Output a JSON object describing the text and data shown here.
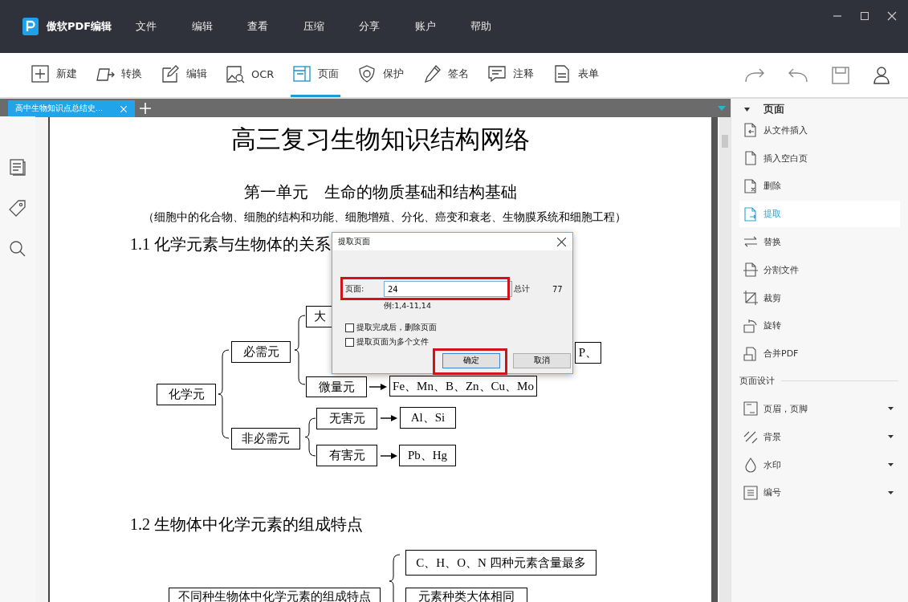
{
  "app": {
    "name": "傲软PDF编辑",
    "menu": [
      "文件",
      "编辑",
      "查看",
      "压缩",
      "分享",
      "账户",
      "帮助"
    ]
  },
  "toolbar": {
    "tools": [
      {
        "label": "新建",
        "kind": "plus",
        "selected": false
      },
      {
        "label": "转换",
        "kind": "convert",
        "selected": false
      },
      {
        "label": "编辑",
        "kind": "edit",
        "selected": false
      },
      {
        "label": "OCR",
        "kind": "ocr",
        "selected": false
      },
      {
        "label": "页面",
        "kind": "page",
        "selected": true
      },
      {
        "label": "保护",
        "kind": "shield",
        "selected": false
      },
      {
        "label": "签名",
        "kind": "pen",
        "selected": false
      },
      {
        "label": "注释",
        "kind": "comment",
        "selected": false
      },
      {
        "label": "表单",
        "kind": "form",
        "selected": false
      }
    ]
  },
  "tabs": [
    {
      "label": "高中生物知识点总结史...",
      "selected": true
    }
  ],
  "document": {
    "title": "高三复习生物知识结构网络",
    "unit": "第一单元　生命的物质基础和结构基础",
    "subtitle": "（细胞中的化合物、细胞的结构和功能、细胞增殖、分化、癌变和衰老、生物膜系统和细胞工程）",
    "sections": [
      {
        "heading": "1.1 化学元素与生物体的关系",
        "nodes": [
          {
            "text": "化学元"
          },
          {
            "text": "必需元"
          },
          {
            "text": "非必需元"
          },
          {
            "text": "大"
          },
          {
            "text": "微量元"
          },
          {
            "text": "Fe、Mn、B、Zn、Cu、Mo"
          },
          {
            "text": "P、"
          },
          {
            "text": "无害元"
          },
          {
            "text": "Al、Si"
          },
          {
            "text": "有害元"
          },
          {
            "text": "Pb、Hg"
          }
        ]
      },
      {
        "heading": "1.2 生物体中化学元素的组成特点",
        "nodes": [
          {
            "text": "C、H、O、N 四种元素含量最多"
          },
          {
            "text": "不同种生物体中化学元素的组成特点"
          },
          {
            "text": "元素种类大体相同"
          }
        ]
      }
    ]
  },
  "dialog": {
    "title": "提取页面",
    "field_label": "页面:",
    "value": "24",
    "total_label": "总计",
    "total": "77",
    "hint": "例:1,4-11,14",
    "options": [
      {
        "label": "提取完成后，删除页面",
        "checked": false
      },
      {
        "label": "提取页面为多个文件",
        "checked": false
      }
    ],
    "buttons": [
      "确定",
      "取消"
    ]
  },
  "panel": {
    "sections": [
      {
        "title": "页面",
        "expanded": true,
        "items": [
          {
            "label": "从文件插入",
            "kind": "insert",
            "selected": false,
            "dropdown": false
          },
          {
            "label": "插入空白页",
            "kind": "blank",
            "selected": false,
            "dropdown": false
          },
          {
            "label": "删除",
            "kind": "delete",
            "selected": false,
            "dropdown": false
          },
          {
            "label": "提取",
            "kind": "extract",
            "selected": true,
            "dropdown": false
          },
          {
            "label": "替换",
            "kind": "replace",
            "selected": false,
            "dropdown": false
          },
          {
            "label": "分割文件",
            "kind": "split",
            "selected": false,
            "dropdown": false
          },
          {
            "label": "裁剪",
            "kind": "crop",
            "selected": false,
            "dropdown": false
          },
          {
            "label": "旋转",
            "kind": "rotate",
            "selected": false,
            "dropdown": false
          },
          {
            "label": "合并PDF",
            "kind": "merge",
            "selected": false,
            "dropdown": false
          }
        ]
      },
      {
        "title": "页面设计",
        "items": [
          {
            "label": "页眉，页脚",
            "kind": "header",
            "selected": false,
            "dropdown": true
          },
          {
            "label": "背景",
            "kind": "background",
            "selected": false,
            "dropdown": true
          },
          {
            "label": "水印",
            "kind": "drop",
            "selected": false,
            "dropdown": true
          },
          {
            "label": "编号",
            "kind": "number",
            "selected": false,
            "dropdown": true
          }
        ]
      }
    ]
  }
}
